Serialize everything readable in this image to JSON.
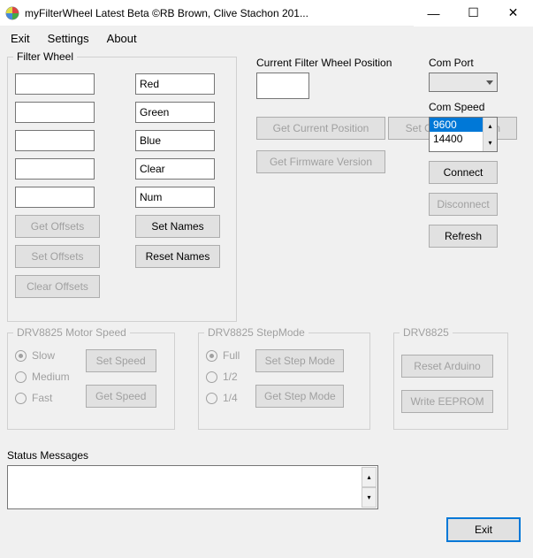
{
  "window": {
    "title": "myFilterWheel Latest Beta ©RB Brown, Clive Stachon 201...",
    "min": "—",
    "max": "☐",
    "close": "✕"
  },
  "menu": {
    "exit": "Exit",
    "settings": "Settings",
    "about": "About"
  },
  "filterWheel": {
    "label": "Filter Wheel",
    "offsets": [
      "",
      "",
      "",
      "",
      ""
    ],
    "names": [
      "Red",
      "Green",
      "Blue",
      "Clear",
      "Num"
    ],
    "btnGetOffsets": "Get Offsets",
    "btnSetOffsets": "Set Offsets",
    "btnClearOffsets": "Clear Offsets",
    "btnSetNames": "Set Names",
    "btnResetNames": "Reset Names"
  },
  "position": {
    "label": "Current Filter Wheel Position",
    "value": "",
    "btnGet": "Get Current Position",
    "btnSet": "Set Current Position",
    "btnFw": "Get Firmware Version"
  },
  "com": {
    "portLabel": "Com Port",
    "speedLabel": "Com Speed",
    "speeds": [
      "9600",
      "14400"
    ],
    "btnConnect": "Connect",
    "btnDisconnect": "Disconnect",
    "btnRefresh": "Refresh"
  },
  "motorSpeed": {
    "label": "DRV8825 Motor Speed",
    "optSlow": "Slow",
    "optMedium": "Medium",
    "optFast": "Fast",
    "btnSet": "Set Speed",
    "btnGet": "Get Speed"
  },
  "stepMode": {
    "label": "DRV8825 StepMode",
    "optFull": "Full",
    "optHalf": "1/2",
    "optQuarter": "1/4",
    "btnSet": "Set Step Mode",
    "btnGet": "Get Step Mode"
  },
  "drv": {
    "label": "DRV8825",
    "btnReset": "Reset Arduino",
    "btnWrite": "Write EEPROM"
  },
  "status": {
    "label": "Status Messages"
  },
  "footer": {
    "exit": "Exit"
  }
}
